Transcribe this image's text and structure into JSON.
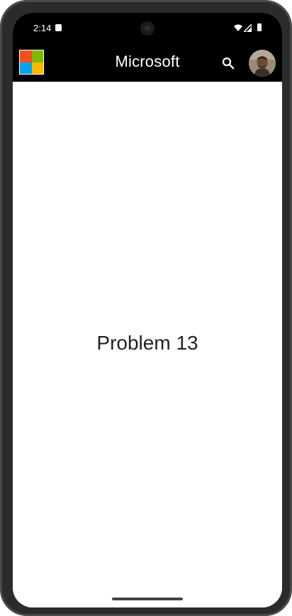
{
  "status_bar": {
    "time": "2:14",
    "icons": [
      "notification-badge-icon",
      "wifi-icon",
      "cellular-signal-icon",
      "battery-icon"
    ]
  },
  "app_bar": {
    "title": "Microsoft",
    "logo": "microsoft-logo",
    "actions": [
      "search-icon",
      "avatar"
    ]
  },
  "content": {
    "title": "Problem 13"
  },
  "colors": {
    "app_bar_bg": "#000000",
    "content_bg": "#ffffff",
    "logo_red": "#f25022",
    "logo_green": "#7fba00",
    "logo_blue": "#00a4ef",
    "logo_yellow": "#ffb900"
  }
}
